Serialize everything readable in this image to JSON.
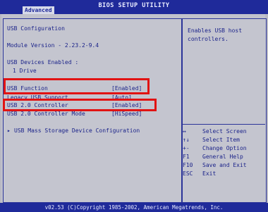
{
  "header": {
    "title": "BIOS SETUP UTILITY",
    "active_tab": "Advanced"
  },
  "left": {
    "section_title": "USB Configuration",
    "module_version": "Module Version - 2.23.2-9.4",
    "devices_label": "USB Devices Enabled :",
    "devices_value": "1 Drive",
    "options": [
      {
        "label": "USB Function",
        "value": "[Enabled]"
      },
      {
        "label": "Legacy USB Support",
        "value": "[Auto]"
      },
      {
        "label": "USB 2.0 Controller",
        "value": "[Enabled]"
      },
      {
        "label": "USB 2.0 Controller Mode",
        "value": "[HiSpeed]"
      }
    ],
    "submenu": "USB Mass Storage Device Configuration"
  },
  "right": {
    "help": [
      "Enables USB host",
      "controllers."
    ],
    "keys": [
      {
        "key": "↔",
        "desc": "Select Screen"
      },
      {
        "key": "↑↓",
        "desc": "Select Item"
      },
      {
        "key": "+-",
        "desc": "Change Option"
      },
      {
        "key": "F1",
        "desc": "General Help"
      },
      {
        "key": "F10",
        "desc": "Save and Exit"
      },
      {
        "key": "ESC",
        "desc": "Exit"
      }
    ]
  },
  "footer": {
    "text": "v02.53 (C)Copyright 1985-2002, American Megatrends, Inc."
  }
}
